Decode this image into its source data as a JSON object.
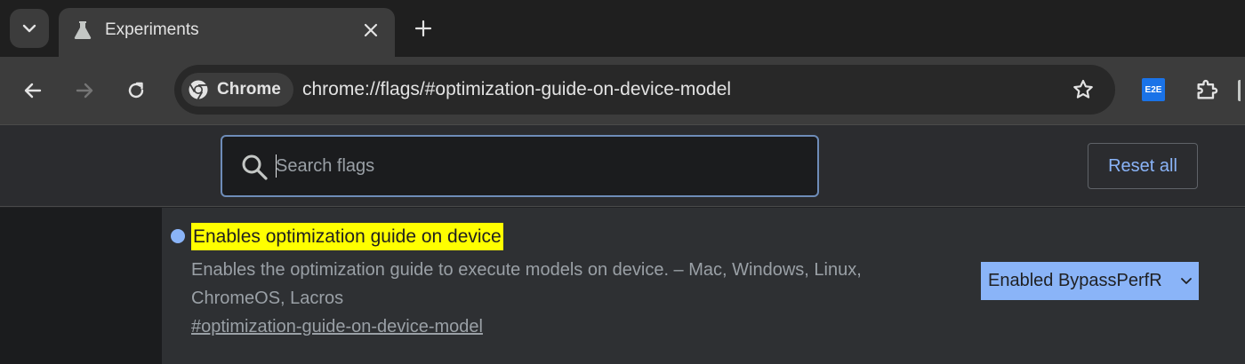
{
  "tab": {
    "title": "Experiments"
  },
  "omnibox": {
    "chip_label": "Chrome",
    "url": "chrome://flags/#optimization-guide-on-device-model"
  },
  "extensions": {
    "e2e_label": "E2E"
  },
  "search": {
    "placeholder": "Search flags",
    "value": ""
  },
  "reset_label": "Reset all",
  "flag": {
    "title": "Enables optimization guide on device",
    "description": "Enables the optimization guide to execute models on device. – Mac, Windows, Linux, ChromeOS, Lacros",
    "link": "#optimization-guide-on-device-model",
    "selected_option": "Enabled BypassPerfR"
  },
  "colors": {
    "accent": "#8ab4f8",
    "highlight": "#ffff00",
    "background": "#202124"
  }
}
